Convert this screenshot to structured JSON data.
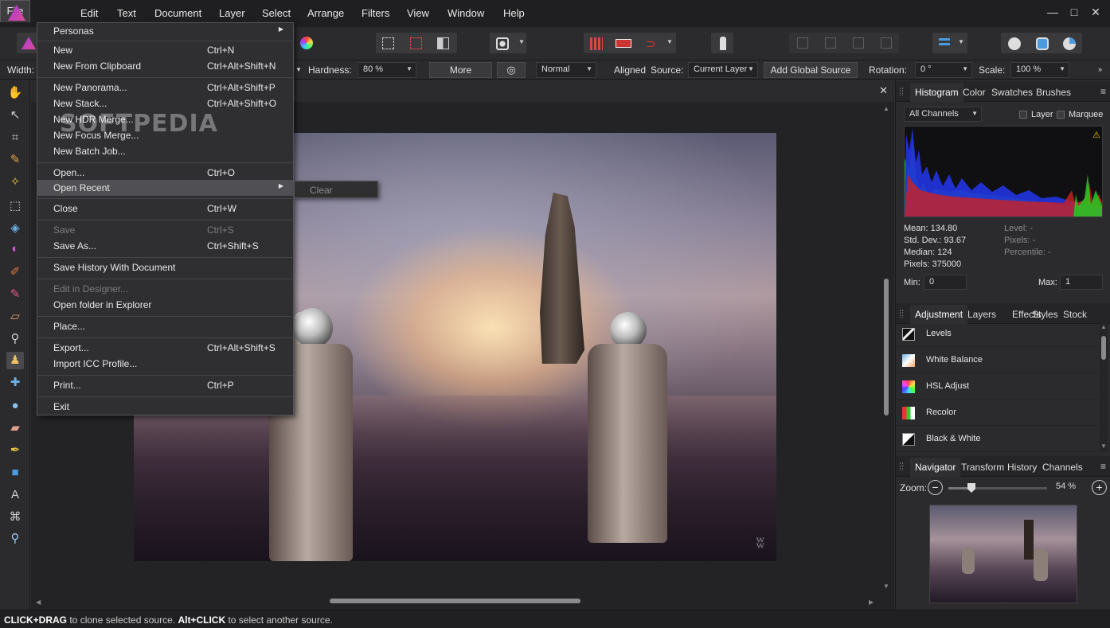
{
  "menubar": {
    "items": [
      "File",
      "Edit",
      "Text",
      "Document",
      "Layer",
      "Select",
      "Arrange",
      "Filters",
      "View",
      "Window",
      "Help"
    ]
  },
  "window_controls": {
    "minimize": "—",
    "maximize": "□",
    "close": "✕"
  },
  "context": {
    "width_label": "Width:",
    "hardness_label": "Hardness:",
    "hardness_value": "80 %",
    "more_button": "More",
    "blend_mode": "Normal",
    "aligned_label": "Aligned",
    "aligned_checked": true,
    "source_label": "Source:",
    "source_value": "Current Layer",
    "add_global_source": "Add Global Source",
    "rotation_label": "Rotation:",
    "rotation_value": "0 °",
    "scale_label": "Scale:",
    "scale_value": "100 %"
  },
  "file_menu": {
    "items": [
      {
        "label": "Personas",
        "shortcut": "",
        "submenu": true,
        "disabled": false
      },
      {
        "label": "New",
        "shortcut": "Ctrl+N",
        "disabled": false
      },
      {
        "label": "New From Clipboard",
        "shortcut": "Ctrl+Alt+Shift+N",
        "disabled": false
      },
      {
        "label": "New Panorama...",
        "shortcut": "Ctrl+Alt+Shift+P",
        "disabled": false
      },
      {
        "label": "New Stack...",
        "shortcut": "Ctrl+Alt+Shift+O",
        "disabled": false
      },
      {
        "label": "New HDR Merge...",
        "shortcut": "",
        "disabled": false
      },
      {
        "label": "New Focus Merge...",
        "shortcut": "",
        "disabled": false
      },
      {
        "label": "New Batch Job...",
        "shortcut": "",
        "disabled": false
      },
      {
        "label": "Open...",
        "shortcut": "Ctrl+O",
        "disabled": false
      },
      {
        "label": "Open Recent",
        "shortcut": "",
        "submenu": true,
        "disabled": false
      },
      {
        "label": "Close",
        "shortcut": "Ctrl+W",
        "disabled": false
      },
      {
        "label": "Save",
        "shortcut": "Ctrl+S",
        "disabled": true
      },
      {
        "label": "Save As...",
        "shortcut": "Ctrl+Shift+S",
        "disabled": false
      },
      {
        "label": "Save History With Document",
        "shortcut": "",
        "disabled": false
      },
      {
        "label": "Edit in Designer...",
        "shortcut": "",
        "disabled": true
      },
      {
        "label": "Open folder in Explorer",
        "shortcut": "",
        "disabled": false
      },
      {
        "label": "Place...",
        "shortcut": "",
        "disabled": false
      },
      {
        "label": "Export...",
        "shortcut": "Ctrl+Alt+Shift+S",
        "disabled": false
      },
      {
        "label": "Import ICC Profile...",
        "shortcut": "",
        "disabled": false
      },
      {
        "label": "Print...",
        "shortcut": "Ctrl+P",
        "disabled": false
      },
      {
        "label": "Exit",
        "shortcut": "",
        "disabled": false
      }
    ],
    "open_recent_submenu": [
      "Clear"
    ]
  },
  "watermark": "SOFTPEDIA",
  "histogram_panel": {
    "tabs": [
      "Histogram",
      "Color",
      "Swatches",
      "Brushes"
    ],
    "channel": "All Channels",
    "layer_label": "Layer",
    "marquee_label": "Marquee",
    "mean": "Mean: 134.80",
    "std_dev": "Std. Dev.: 93.67",
    "median": "Median: 124",
    "pixels": "Pixels: 375000",
    "level": "Level: -",
    "pixels_r": "Pixels: -",
    "percentile": "Percentile: -",
    "min_label": "Min:",
    "min_value": "0",
    "max_label": "Max:",
    "max_value": "1"
  },
  "adjustment_panel": {
    "tabs": [
      "Adjustment",
      "Layers",
      "Effects",
      "Styles",
      "Stock"
    ],
    "items": [
      "Levels",
      "White Balance",
      "HSL Adjust",
      "Recolor",
      "Black & White"
    ]
  },
  "navigator_panel": {
    "tabs": [
      "Navigator",
      "Transform",
      "History",
      "Channels"
    ],
    "zoom_label": "Zoom:",
    "zoom_value": "54 %",
    "zoom_fraction": 0.54
  },
  "status": {
    "k1": "CLICK+DRAG",
    "t1": " to clone selected source. ",
    "k2": "Alt+CLICK",
    "t2": " to select another source."
  }
}
